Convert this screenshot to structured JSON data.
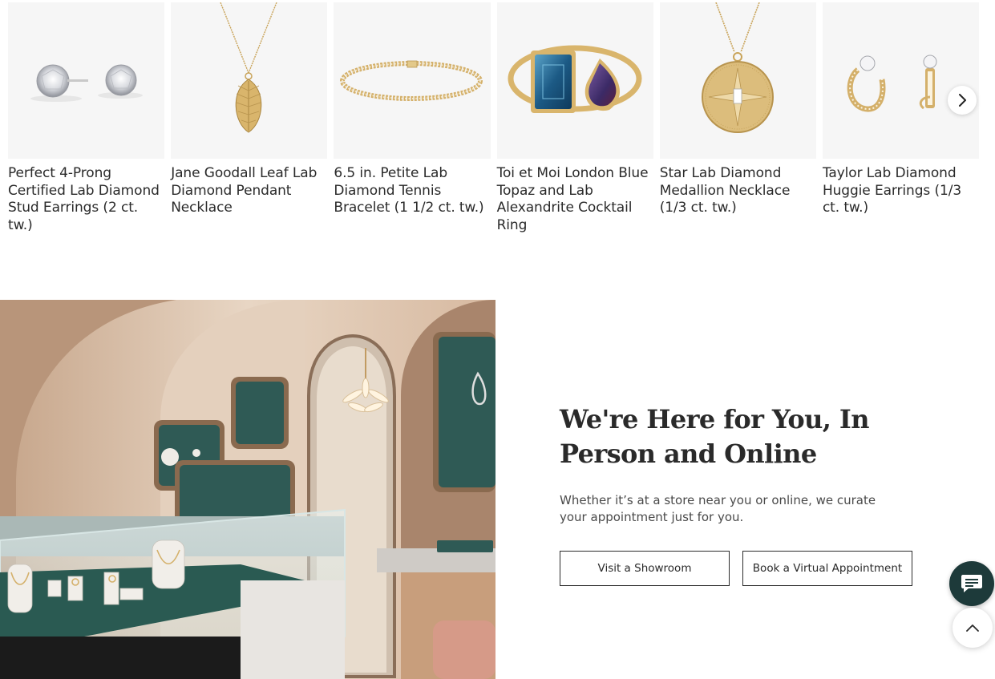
{
  "products": [
    {
      "title": "Perfect 4-Prong Certified Lab Diamond Stud Earrings (2 ct. tw.)",
      "image_icon": "stud-earrings-image"
    },
    {
      "title": "Jane Goodall Leaf Lab Diamond Pendant Necklace",
      "image_icon": "leaf-pendant-image"
    },
    {
      "title": "6.5 in. Petite Lab Diamond Tennis Bracelet (1 1/2 ct. tw.)",
      "image_icon": "tennis-bracelet-image"
    },
    {
      "title": "Toi et Moi London Blue Topaz and Lab Alexandrite Cocktail Ring",
      "image_icon": "cocktail-ring-image"
    },
    {
      "title": "Star Lab Diamond Medallion Necklace (1/3 ct. tw.)",
      "image_icon": "medallion-necklace-image"
    },
    {
      "title": "Taylor Lab Diamond Huggie Earrings (1/3 ct. tw.)",
      "image_icon": "huggie-earrings-image"
    }
  ],
  "carousel": {
    "next_icon": "chevron-right-icon"
  },
  "promo": {
    "title": "We're Here for You, In Person and Online",
    "text": "Whether it’s at a store near you or online, we curate your appointment just for you.",
    "visit_label": "Visit a Showroom",
    "virtual_label": "Book a Virtual Appointment"
  },
  "floating": {
    "chat_icon": "chat-icon",
    "top_icon": "chevron-up-icon"
  },
  "colors": {
    "gold": "#d4b06a",
    "accent_dark": "#1d3a3a",
    "card_bg": "#f6f6f6"
  }
}
